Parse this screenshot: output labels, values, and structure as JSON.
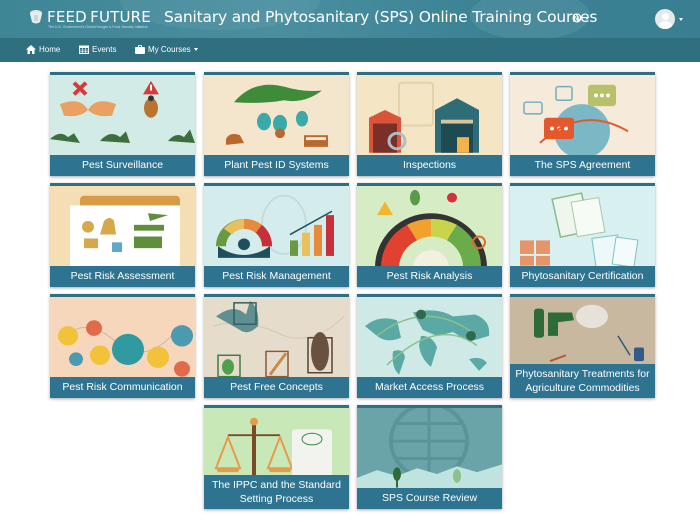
{
  "header": {
    "logo_text": "FEED FUTURE",
    "logo_subtitle": "The U.S. Government's Global Hunger & Food Security Initiative",
    "title": "Sanitary and Phytosanitary (SPS) Online Training Courses",
    "language_icon": "globe-icon",
    "user_icon": "user-avatar-icon"
  },
  "nav": {
    "items": [
      {
        "label": "Home",
        "icon": "home-icon"
      },
      {
        "label": "Events",
        "icon": "calendar-icon"
      },
      {
        "label": "My Courses",
        "icon": "briefcase-icon",
        "dropdown": true
      }
    ]
  },
  "colors": {
    "header_bg": "#3e8596",
    "nav_bg": "#2f6f80",
    "tile_label_bg": "#2e7390",
    "tile_border": "#2d6f85"
  },
  "courses": [
    {
      "label": "Pest Surveillance"
    },
    {
      "label": "Plant Pest ID Systems"
    },
    {
      "label": "Inspections"
    },
    {
      "label": "The SPS Agreement"
    },
    {
      "label": "Pest Risk Assessment"
    },
    {
      "label": "Pest Risk Management"
    },
    {
      "label": "Pest Risk Analysis"
    },
    {
      "label": "Phytosanitary Certification"
    },
    {
      "label": "Pest Risk Communication"
    },
    {
      "label": "Pest Free Concepts"
    },
    {
      "label": "Market Access Process"
    },
    {
      "label": "Phytosanitary Treatments for Agriculture Commodities"
    },
    {
      "label": "The IPPC and the Standard Setting Process"
    },
    {
      "label": "SPS Course Review"
    }
  ]
}
